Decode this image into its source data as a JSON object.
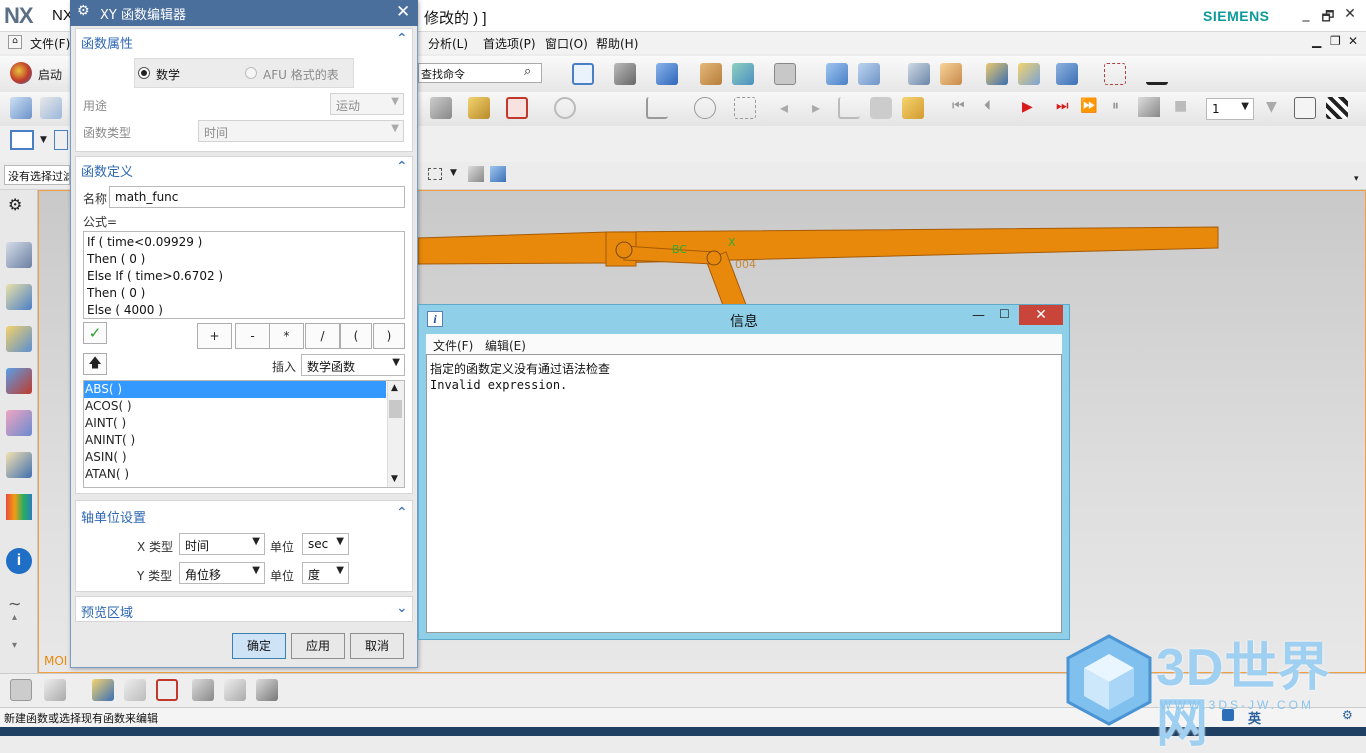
{
  "app": {
    "logo": "NX",
    "title_left": "NX",
    "title_right": "修改的 ) ]",
    "brand": "SIEMENS",
    "window_buttons": [
      "_",
      "🗗",
      "✕"
    ]
  },
  "menubar": {
    "left": [
      "文件(F)"
    ],
    "right": [
      "分析(L)",
      "首选项(P)",
      "窗口(O)",
      "帮助(H)"
    ]
  },
  "toolbar": {
    "start_label": "启动",
    "search_placeholder": "查找命令",
    "filter_value": "没有选择过滤",
    "frame_value": "1"
  },
  "dialog": {
    "title": "XY 函数编辑器",
    "close": "✕",
    "section_props": {
      "header": "函数属性",
      "radio_math": "数学",
      "radio_afu": "AFU 格式的表",
      "usage_label": "用途",
      "usage_value": "运动",
      "type_label": "函数类型",
      "type_value": "时间"
    },
    "section_def": {
      "header": "函数定义",
      "name_label": "名称",
      "name_value": "math_func",
      "formula_label": "公式=",
      "formula_lines": [
        "If ( time<0.09929 )",
        "Then ( 0 )",
        "Else If ( time>0.6702 )",
        "Then ( 0 )",
        "Else ( 4000 )"
      ],
      "ops": [
        "+",
        "-",
        "*",
        "/",
        "(",
        ")"
      ],
      "insert_label": "插入",
      "insert_value": "数学函数",
      "functions": [
        "ABS( )",
        "ACOS( )",
        "AINT( )",
        "ANINT( )",
        "ASIN( )",
        "ATAN( )"
      ]
    },
    "section_axis": {
      "header": "轴单位设置",
      "x_type_label": "X 类型",
      "x_type_value": "时间",
      "x_unit_label": "单位",
      "x_unit_value": "sec",
      "y_type_label": "Y 类型",
      "y_type_value": "角位移",
      "y_unit_label": "单位",
      "y_unit_value": "度"
    },
    "section_preview": {
      "header": "预览区域"
    },
    "buttons": {
      "ok": "确定",
      "apply": "应用",
      "cancel": "取消"
    }
  },
  "viewport": {
    "label_bc": "BC",
    "label_x": "X",
    "label_004": "004",
    "mode_label": "MOI"
  },
  "info_window": {
    "icon": "i",
    "title": "信息",
    "menu": [
      "文件(F)",
      "编辑(E)"
    ],
    "lines": [
      "指定的函数定义没有通过语法检查",
      "Invalid expression."
    ]
  },
  "status": {
    "text": "新建函数或选择现有函数来编辑"
  },
  "watermark": {
    "text": "3D世界网",
    "url": "WWW.3DS-JW.COM"
  },
  "tray": {
    "ime": "英"
  },
  "colors": {
    "dialog_title": "#4a6f9c",
    "section_header": "#2d67b2",
    "info_frame": "#8fd0e8",
    "close_red": "#c9453a",
    "linkage": "#e8890c",
    "brand": "#0c9a9a"
  }
}
